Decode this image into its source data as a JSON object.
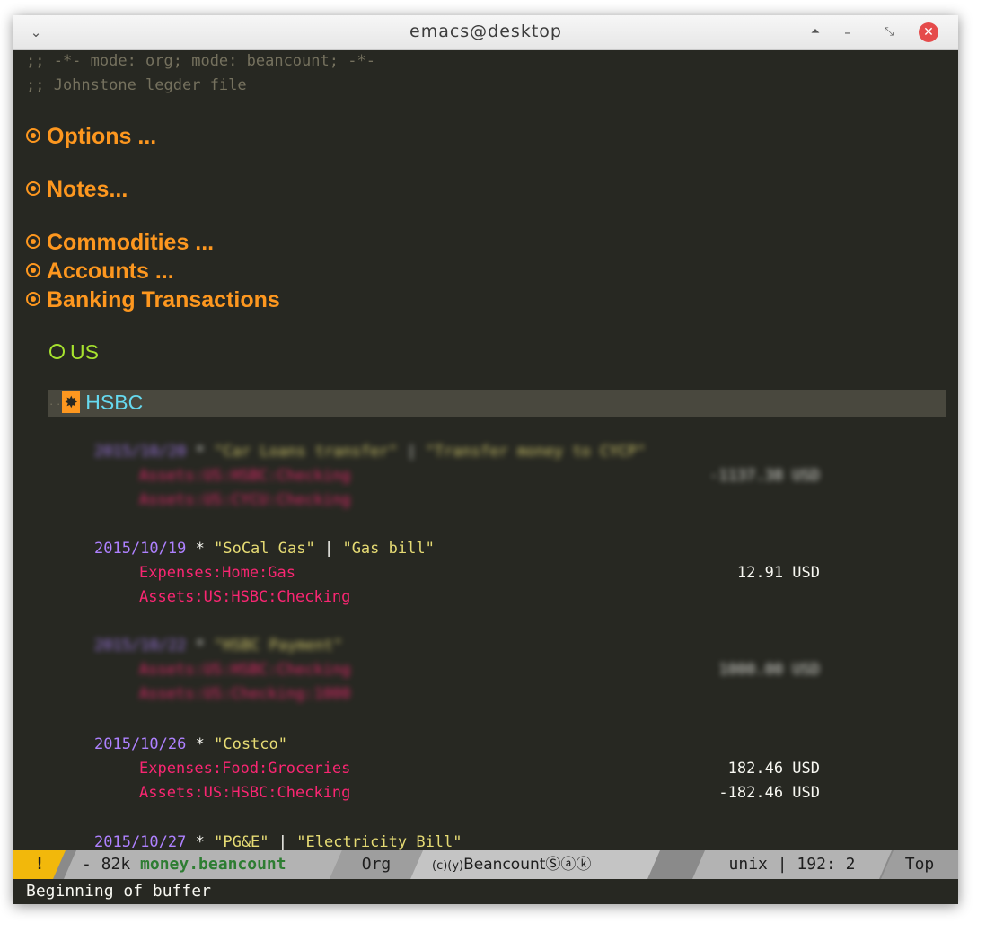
{
  "window": {
    "title": "emacs@desktop",
    "icons": {
      "menu": "chevron-down-icon",
      "up": "eject-icon",
      "minimize": "minimize-icon",
      "restore": "restore-icon",
      "close": "close-icon"
    }
  },
  "buffer": {
    "comments": [
      ";; -*- mode: org; mode: beancount; -*-",
      ";; Johnstone legder file"
    ],
    "headings": [
      "Options ...",
      "Notes...",
      "Commodities ...",
      "Accounts ...",
      "Banking Transactions"
    ],
    "subheading": "US",
    "current_heading": "HSBC",
    "blurred_txn1": {
      "date": "2015/10/20",
      "flag": "*",
      "payee": "\"Car Loans transfer\"",
      "sep": "|",
      "narration": "\"Transfer money to CYCP\"",
      "postings": [
        {
          "account": "Assets:US:HSBC:Checking",
          "amount": "-1137.38 USD"
        },
        {
          "account": "Assets:US:CYCU:Checking",
          "amount": ""
        }
      ]
    },
    "txn1": {
      "date": "2015/10/19",
      "flag": "*",
      "payee": "\"SoCal Gas\"",
      "sep": "|",
      "narration": "\"Gas bill\"",
      "postings": [
        {
          "account": "Expenses:Home:Gas",
          "amount": "12.91 USD"
        },
        {
          "account": "Assets:US:HSBC:Checking",
          "amount": ""
        }
      ]
    },
    "blurred_txn2": {
      "date": "2015/10/22",
      "flag": "*",
      "payee": "\"HSBC Payment\"",
      "postings": [
        {
          "account": "Assets:US:HSBC:Checking",
          "amount": "1000.00 USD"
        },
        {
          "account": "Assets:US:Checking:1000",
          "amount": ""
        }
      ]
    },
    "txn2": {
      "date": "2015/10/26",
      "flag": "*",
      "payee": "\"Costco\"",
      "postings": [
        {
          "account": "Expenses:Food:Groceries",
          "amount": "182.46 USD"
        },
        {
          "account": "Assets:US:HSBC:Checking",
          "amount": "-182.46 USD"
        }
      ]
    },
    "txn3": {
      "date": "2015/10/27",
      "flag": "*",
      "payee": "\"PG&E\"",
      "sep": "|",
      "narration": "\"Electricity Bill\""
    }
  },
  "modeline": {
    "warning": "!",
    "size": "- 82k ",
    "filename": "money.beancount",
    "major_mode": "Org",
    "minor_prefix": "(c)(y)",
    "minor_mode": "Beancount",
    "minor_suffix": "Ⓢⓐⓚ",
    "line_ending": "unix | 192: 2",
    "position": "Top"
  },
  "echo_area": "Beginning of buffer"
}
